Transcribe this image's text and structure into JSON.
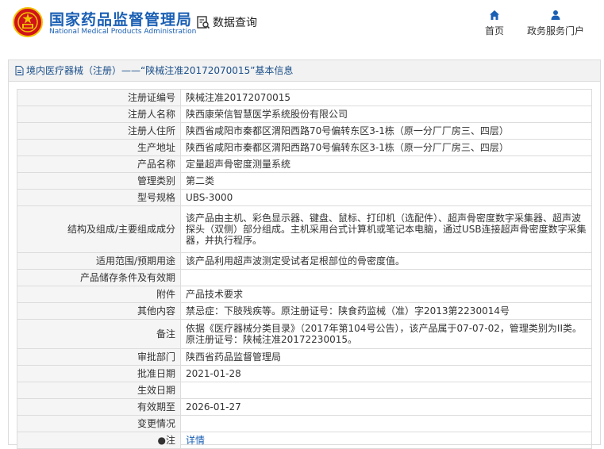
{
  "header": {
    "brand_cn": "国家药品监督管理局",
    "brand_en": "National Medical Products Administration",
    "query_label": "数据查询",
    "nav_home": "首页",
    "nav_services": "政务服务门户",
    "colors": {
      "brand": "#1a5fb4",
      "emblem_red": "#d0121b",
      "emblem_gold": "#f2c200"
    },
    "icons": [
      "national-emblem-icon",
      "search-doc-icon",
      "home-icon",
      "user-icon"
    ]
  },
  "panel": {
    "title": "境内医疗器械（注册）——“陕械注准20172070015”基本信息",
    "rows": [
      {
        "label": "注册证编号",
        "value": "陕械注准20172070015"
      },
      {
        "label": "注册人名称",
        "value": "陕西康荣信智慧医学系统股份有限公司"
      },
      {
        "label": "注册人住所",
        "value": "陕西省咸阳市秦都区渭阳西路70号偏转东区3-1栋（原一分厂厂房三、四层）"
      },
      {
        "label": "生产地址",
        "value": "陕西省咸阳市秦都区渭阳西路70号偏转东区3-1栋（原一分厂厂房三、四层）"
      },
      {
        "label": "产品名称",
        "value": "定量超声骨密度测量系统"
      },
      {
        "label": "管理类别",
        "value": "第二类"
      },
      {
        "label": "型号规格",
        "value": "UBS-3000"
      },
      {
        "label": "结构及组成/主要组成成分",
        "value": "该产品由主机、彩色显示器、键盘、鼠标、打印机（选配件）、超声骨密度数字采集器、超声波探头（双侧）部分组成。主机采用台式计算机或笔记本电脑，通过USB连接超声骨密度数字采集器，并执行程序。"
      },
      {
        "label": "适用范围/预期用途",
        "value": "该产品利用超声波测定受试者足根部位的骨密度值。"
      },
      {
        "label": "产品储存条件及有效期",
        "value": ""
      },
      {
        "label": "附件",
        "value": "产品技术要求"
      },
      {
        "label": "其他内容",
        "value": "禁忌症：下肢残疾等。原注册证号：陕食药监械（准）字2013第2230014号"
      },
      {
        "label": "备注",
        "value": "依据《医疗器械分类目录》（2017年第104号公告），该产品属于07-07-02，管理类别为II类。原注册证号：陕械注准20172230015。"
      },
      {
        "label": "审批部门",
        "value": "陕西省药品监督管理局"
      },
      {
        "label": "批准日期",
        "value": "2021-01-28"
      },
      {
        "label": "生效日期",
        "value": ""
      },
      {
        "label": "有效期至",
        "value": "2026-01-27"
      },
      {
        "label": "变更情况",
        "value": ""
      },
      {
        "label": "注",
        "value": "详情"
      }
    ]
  }
}
